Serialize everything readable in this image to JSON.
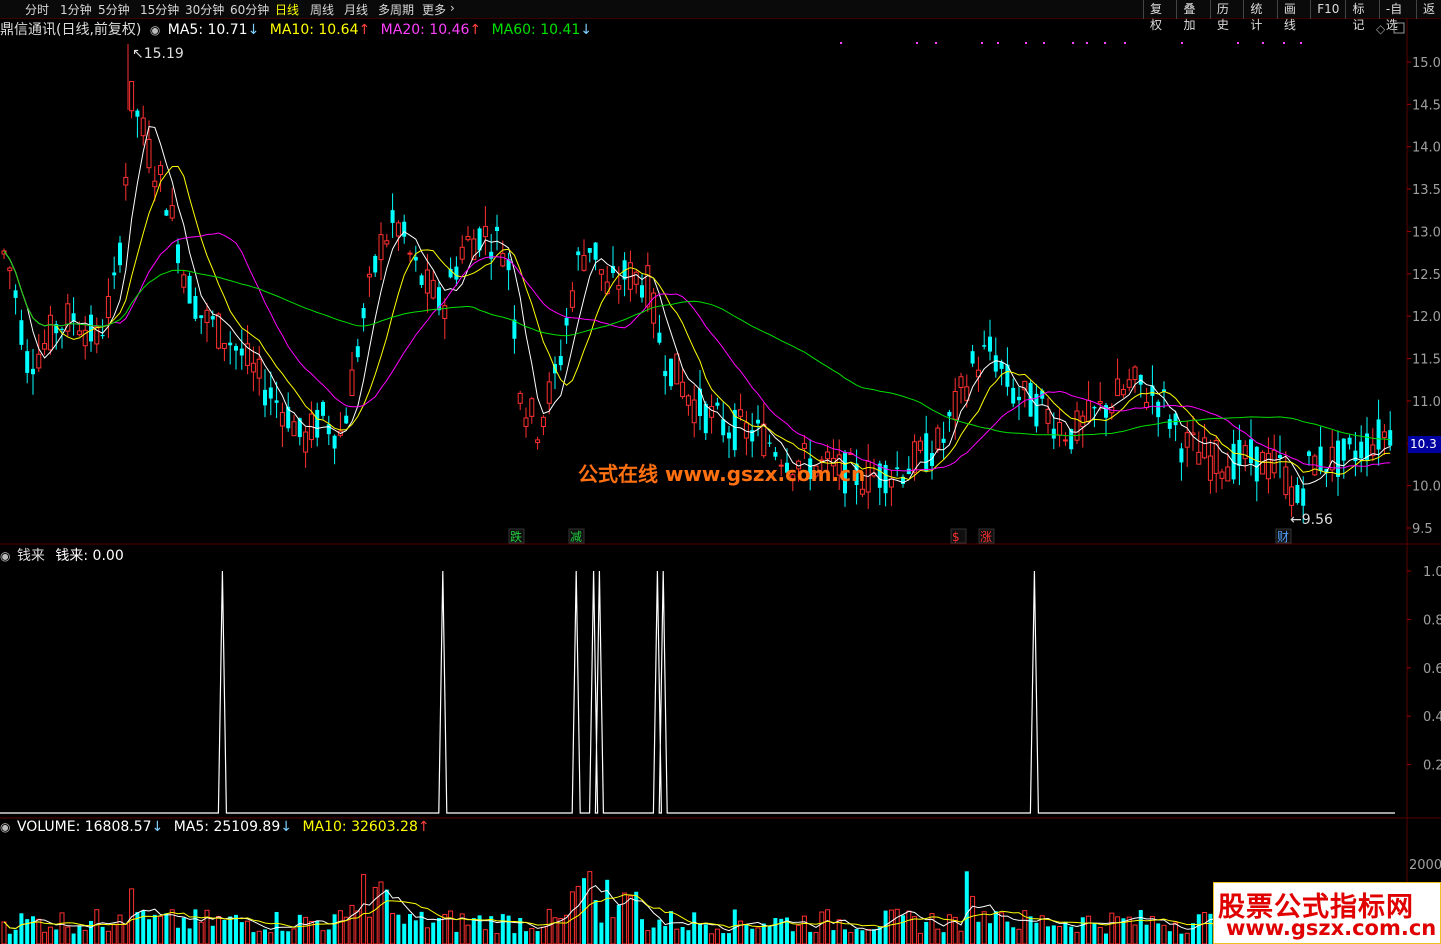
{
  "toolbar": {
    "periods": [
      "分时",
      "1分钟",
      "5分钟",
      "15分钟",
      "30分钟",
      "60分钟",
      "日线",
      "周线",
      "月线",
      "多周期",
      "更多"
    ],
    "selected_index": 6,
    "right_buttons": [
      "复权",
      "叠加",
      "历史",
      "统计",
      "画线",
      "F10",
      "标记",
      "-自选",
      "返"
    ]
  },
  "main_chart": {
    "title": "鼎信通讯(日线,前复权)",
    "ma5": "MA5: 10.71",
    "ma10": "MA10: 10.64",
    "ma20": "MA20: 10.46",
    "ma60": "MA60: 10.41",
    "arrow_down": "↓",
    "arrow_up": "↑",
    "high_label": "15.19",
    "low_label": "9.56",
    "current_price": "10.3",
    "price_axis": [
      "15.0",
      "14.5",
      "14.0",
      "13.5",
      "13.0",
      "12.5",
      "12.0",
      "11.5",
      "11.0",
      "10.5",
      "10.0",
      "9.5"
    ],
    "markers": [
      {
        "text": "跌",
        "color": "#20d040"
      },
      {
        "text": "减",
        "color": "#20d040"
      },
      {
        "text": "$",
        "color": "#ff3030"
      },
      {
        "text": "涨",
        "color": "#ff3030"
      },
      {
        "text": "财",
        "color": "#50a0ff"
      }
    ],
    "colors": {
      "ma5": "#ffffff",
      "ma10": "#ffff00",
      "ma20": "#ff00ff",
      "ma60": "#00e000",
      "up": "#ff3030",
      "down": "#00ffff"
    }
  },
  "watermark": {
    "text": "公式在线 www.gszx.com.cn"
  },
  "indicator_panel": {
    "title": "钱来",
    "value_label": "钱来: 0.00",
    "axis": [
      "1.0",
      "0.8",
      "0.6",
      "0.4",
      "0.2"
    ],
    "chart_data": {
      "type": "line",
      "ylim": [
        0,
        1
      ],
      "spikes_at_bar_index": [
        38,
        76,
        99,
        102,
        103,
        113,
        114,
        178
      ],
      "baseline_value": 0,
      "spike_value": 1
    }
  },
  "volume_panel": {
    "title": "VOLUME: 16808.57",
    "ma5": "MA5: 25109.89",
    "ma10": "MA10: 32603.28",
    "arrow_down": "↓",
    "arrow_up": "↑",
    "axis_label": "2000"
  },
  "badge": {
    "line1": "股票公式指标网",
    "line2": "www.gszx.com.cn"
  }
}
